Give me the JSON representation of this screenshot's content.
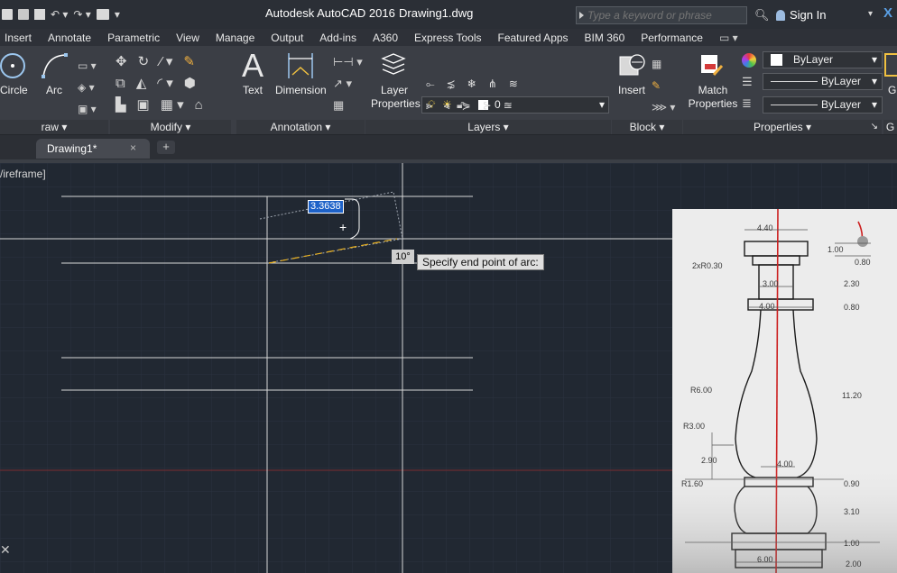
{
  "window": {
    "app_title": "Autodesk AutoCAD 2016",
    "document": "Drawing1.dwg",
    "search_placeholder": "Type a keyword or phrase",
    "sign_in": "Sign In",
    "close": "X"
  },
  "ribbon_tabs": [
    "Insert",
    "Annotate",
    "Parametric",
    "View",
    "Manage",
    "Output",
    "Add-ins",
    "A360",
    "Express Tools",
    "Featured Apps",
    "BIM 360",
    "Performance"
  ],
  "panels": {
    "draw": "raw",
    "modify": "Modify",
    "annotation": "Annotation",
    "layers": "Layers",
    "block": "Block",
    "properties": "Properties",
    "groups": "G"
  },
  "buttons": {
    "circle": "Circle",
    "arc": "Arc",
    "text_letter": "A",
    "text": "Text",
    "dimension": "Dimension",
    "layer_properties": [
      "Layer",
      "Properties"
    ],
    "insert": "Insert",
    "match_properties": [
      "Match",
      "Properties"
    ],
    "group_letter": "G"
  },
  "layer_combo": {
    "value": "0"
  },
  "properties": {
    "color": "ByLayer",
    "linetype": "ByLayer",
    "lineweight": "ByLayer"
  },
  "doc_tab": {
    "label": "Drawing1*",
    "close": "×",
    "add": "+"
  },
  "viewport": {
    "view_label": "/ireframe]",
    "dynamic_input": "3.3638",
    "angle": "10°",
    "prompt": "Specify end point of arc:",
    "crosshair_glyph": "+"
  },
  "reference_labels": {
    "top_width": "4.40",
    "top_height": "1.00",
    "small": "0.80",
    "fillet": "2xR0.30",
    "neck_width": "3.00",
    "neck_h": "2.30",
    "collar_width": "4.00",
    "collar_h": "0.80",
    "r6": "R6.00",
    "body_h": "11.20",
    "r3": "R3.00",
    "w290": "2.90",
    "w400b": "4.00",
    "r160": "R1.60",
    "h090": "0.90",
    "h310": "3.10",
    "h100": "1.00",
    "base_w": "6.00",
    "h200": "2.00"
  },
  "colors": {
    "canvas_bg": "#212832",
    "ribbon_bg": "#3b3e45",
    "highlight": "#1e62c8"
  }
}
